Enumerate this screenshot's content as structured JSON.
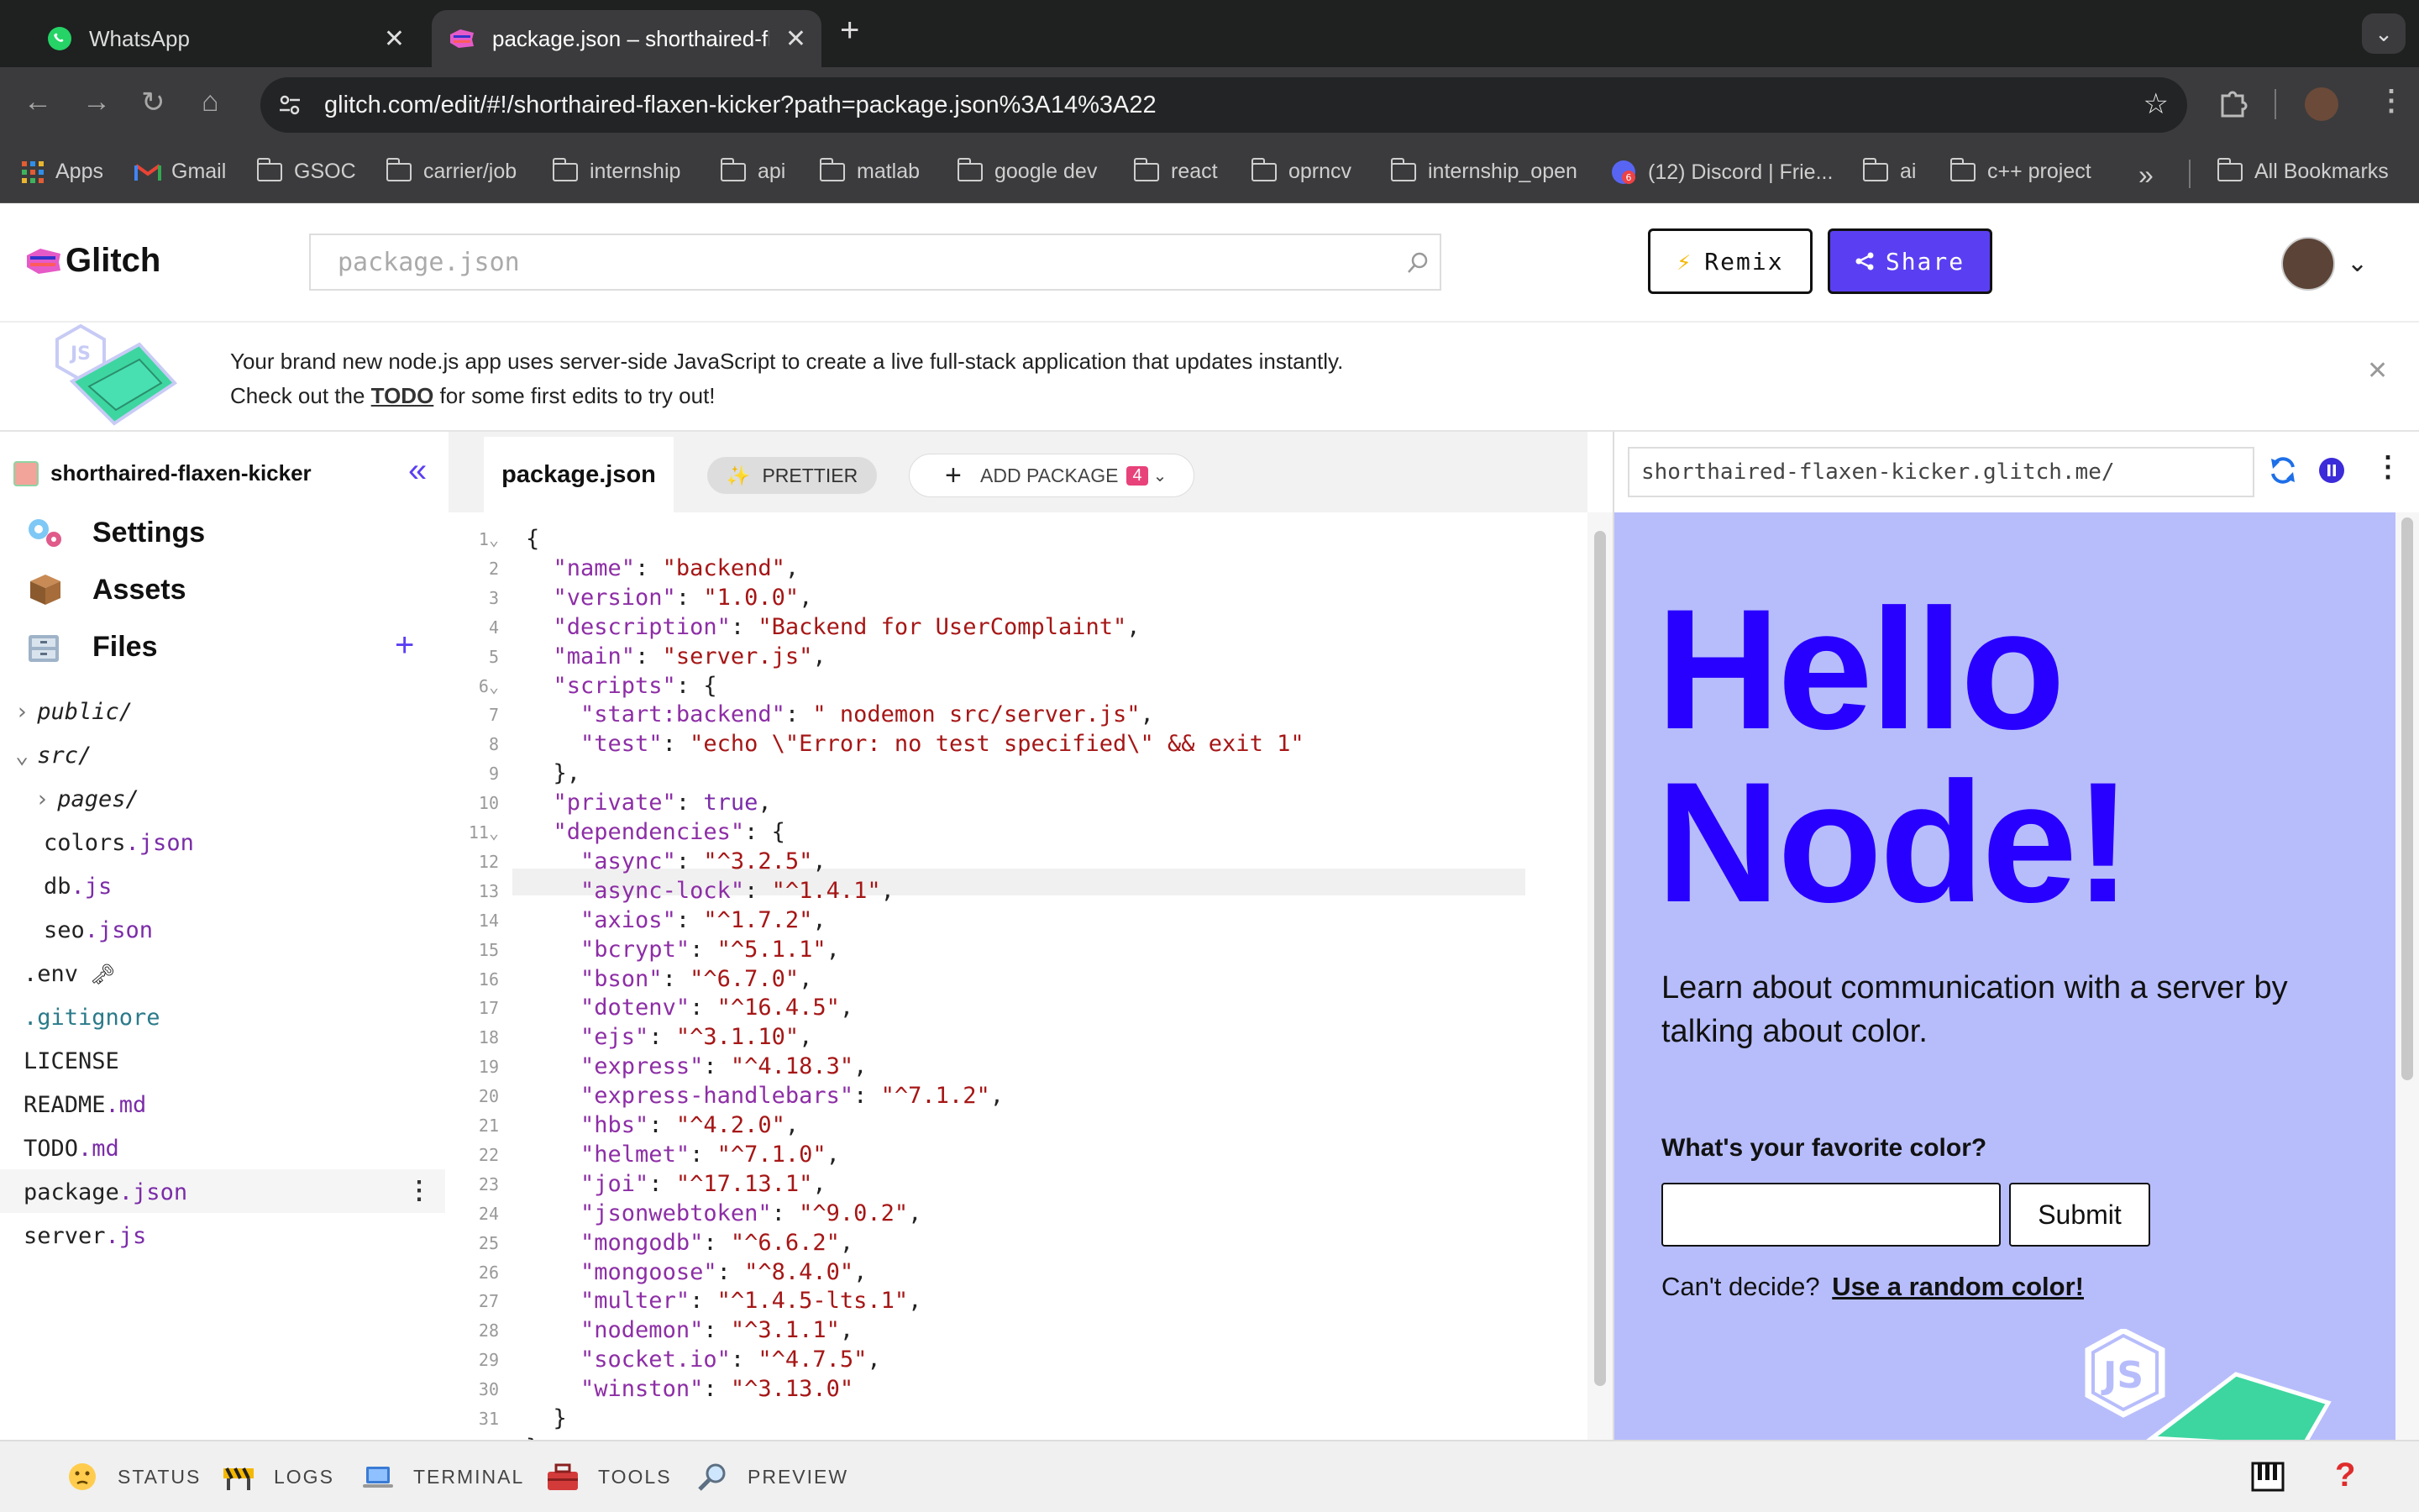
{
  "browser": {
    "tabs": [
      {
        "title": "WhatsApp"
      },
      {
        "title": "package.json – shorthaired-fl"
      }
    ],
    "url": "glitch.com/edit/#!/shorthaired-flaxen-kicker?path=package.json%3A14%3A22",
    "bookmarks": [
      "Apps",
      "Gmail",
      "GSOC",
      "carrier/job",
      "internship",
      "api",
      "matlab",
      "google dev",
      "react",
      "oprncv",
      "internship_open",
      "(12) Discord | Frie...",
      "ai",
      "c++ project"
    ],
    "all_bookmarks": "All Bookmarks"
  },
  "header": {
    "logo": "Glitch",
    "search_value": "package.json",
    "remix": "Remix",
    "share": "Share"
  },
  "banner": {
    "text_before": "Your brand new node.js app uses server-side JavaScript to create a live full-stack application that updates instantly. Check out the ",
    "link": "TODO",
    "text_after": " for some first edits to try out!"
  },
  "sidebar": {
    "project": "shorthaired-flaxen-kicker",
    "settings": "Settings",
    "assets": "Assets",
    "files": "Files",
    "tree": [
      {
        "name": "public/",
        "ext": ""
      },
      {
        "name": "src/",
        "ext": ""
      },
      {
        "name": "pages/",
        "ext": ""
      },
      {
        "name": "colors",
        "ext": ".json"
      },
      {
        "name": "db",
        "ext": ".js"
      },
      {
        "name": "seo",
        "ext": ".json"
      },
      {
        "name": ".env",
        "ext": ""
      },
      {
        "name": ".gitignore",
        "ext": ""
      },
      {
        "name": "LICENSE",
        "ext": ""
      },
      {
        "name": "README",
        "ext": ".md"
      },
      {
        "name": "TODO",
        "ext": ".md"
      },
      {
        "name": "package",
        "ext": ".json"
      },
      {
        "name": "server",
        "ext": ".js"
      }
    ]
  },
  "editor": {
    "tab": "package.json",
    "prettier": "PRETTIER",
    "add_package": "ADD PACKAGE",
    "package_count": "4",
    "lines": [
      [
        "{"
      ],
      [
        "  ",
        "\"name\"",
        ": ",
        "\"backend\"",
        ","
      ],
      [
        "  ",
        "\"version\"",
        ": ",
        "\"1.0.0\"",
        ","
      ],
      [
        "  ",
        "\"description\"",
        ": ",
        "\"Backend for UserComplaint\"",
        ","
      ],
      [
        "  ",
        "\"main\"",
        ": ",
        "\"server.js\"",
        ","
      ],
      [
        "  ",
        "\"scripts\"",
        ": {"
      ],
      [
        "    ",
        "\"start:backend\"",
        ": ",
        "\" nodemon src/server.js\"",
        ","
      ],
      [
        "    ",
        "\"test\"",
        ": ",
        "\"echo \\\"Error: no test specified\\\" && exit 1\""
      ],
      [
        "  },"
      ],
      [
        "  ",
        "\"private\"",
        ": ",
        "true",
        ","
      ],
      [
        "  ",
        "\"dependencies\"",
        ": {"
      ],
      [
        "    ",
        "\"async\"",
        ": ",
        "\"^3.2.5\"",
        ","
      ],
      [
        "    ",
        "\"async-lock\"",
        ": ",
        "\"^1.4.1\"",
        ","
      ],
      [
        "    ",
        "\"axios\"",
        ": ",
        "\"^1.7.2\"",
        ","
      ],
      [
        "    ",
        "\"bcrypt\"",
        ": ",
        "\"^5.1.1\"",
        ","
      ],
      [
        "    ",
        "\"bson\"",
        ": ",
        "\"^6.7.0\"",
        ","
      ],
      [
        "    ",
        "\"dotenv\"",
        ": ",
        "\"^16.4.5\"",
        ","
      ],
      [
        "    ",
        "\"ejs\"",
        ": ",
        "\"^3.1.10\"",
        ","
      ],
      [
        "    ",
        "\"express\"",
        ": ",
        "\"^4.18.3\"",
        ","
      ],
      [
        "    ",
        "\"express-handlebars\"",
        ": ",
        "\"^7.1.2\"",
        ","
      ],
      [
        "    ",
        "\"hbs\"",
        ": ",
        "\"^4.2.0\"",
        ","
      ],
      [
        "    ",
        "\"helmet\"",
        ": ",
        "\"^7.1.0\"",
        ","
      ],
      [
        "    ",
        "\"joi\"",
        ": ",
        "\"^17.13.1\"",
        ","
      ],
      [
        "    ",
        "\"jsonwebtoken\"",
        ": ",
        "\"^9.0.2\"",
        ","
      ],
      [
        "    ",
        "\"mongodb\"",
        ": ",
        "\"^6.6.2\"",
        ","
      ],
      [
        "    ",
        "\"mongoose\"",
        ": ",
        "\"^8.4.0\"",
        ","
      ],
      [
        "    ",
        "\"multer\"",
        ": ",
        "\"^1.4.5-lts.1\"",
        ","
      ],
      [
        "    ",
        "\"nodemon\"",
        ": ",
        "\"^3.1.1\"",
        ","
      ],
      [
        "    ",
        "\"socket.io\"",
        ": ",
        "\"^4.7.5\"",
        ","
      ],
      [
        "    ",
        "\"winston\"",
        ": ",
        "\"^3.13.0\""
      ],
      [
        "  }"
      ],
      [
        "}"
      ],
      [
        ""
      ]
    ]
  },
  "preview": {
    "url": "shorthaired-flaxen-kicker.glitch.me/",
    "heading_line1": "Hello",
    "heading_line2": "Node!",
    "subtitle": "Learn about communication with a server by talking about color.",
    "question": "What's your favorite color?",
    "input_value": "",
    "submit": "Submit",
    "cant_decide": "Can't decide?",
    "random_link": "Use a random color!"
  },
  "statusbar": {
    "items": [
      "STATUS",
      "LOGS",
      "TERMINAL",
      "TOOLS",
      "PREVIEW"
    ]
  },
  "colors": {
    "accent": "#5a3ff2",
    "preview_bg": "#b7bdfb",
    "preview_heading": "#2800ff"
  }
}
